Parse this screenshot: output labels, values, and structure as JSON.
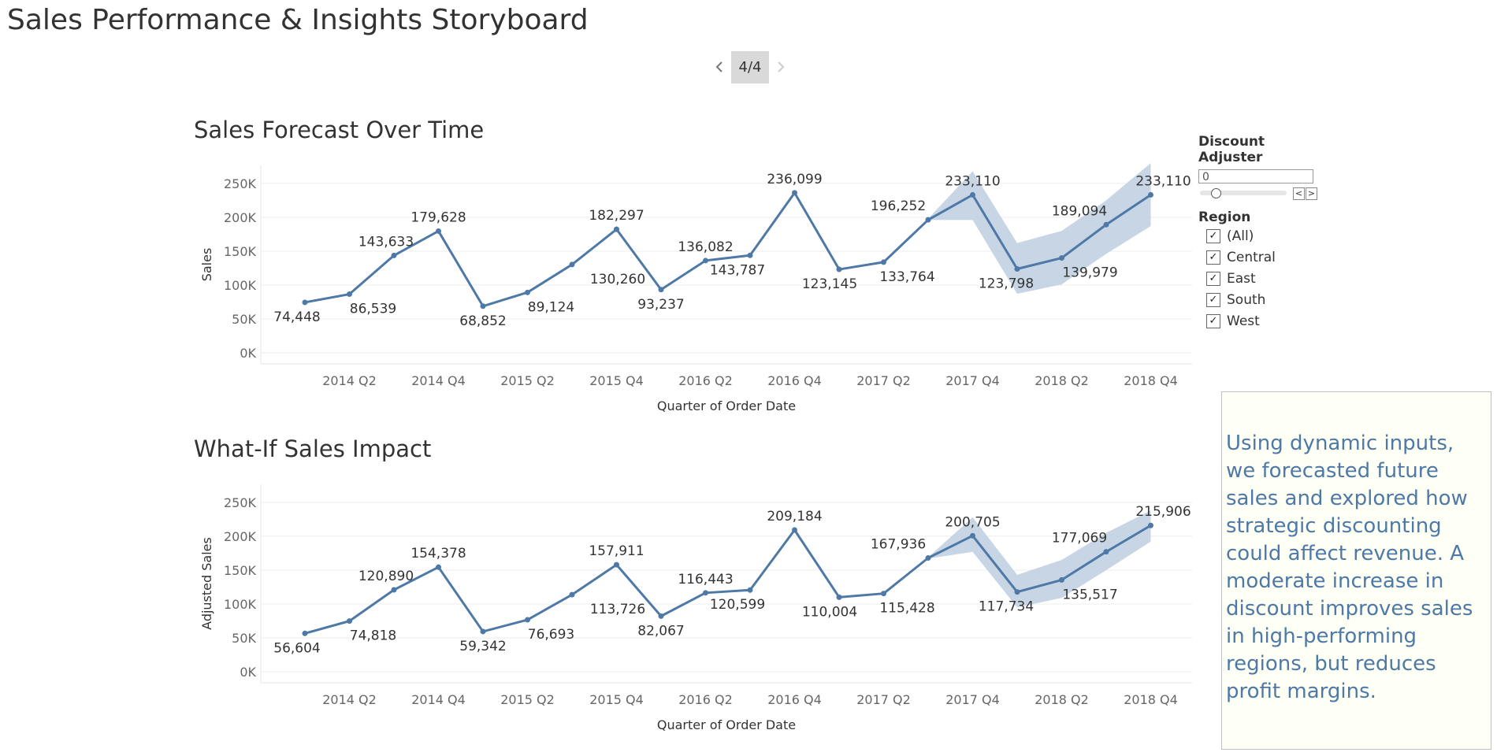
{
  "story_title": "Sales Performance & Insights Storyboard",
  "navigator": {
    "prev_icon": "chevron-left-icon",
    "next_icon": "chevron-right-icon",
    "page_label": "4/4"
  },
  "colors": {
    "line": "#4e79a7",
    "band": "#c1d0e1",
    "note_text": "#4e79a7",
    "note_bg": "#fefff5"
  },
  "controls": {
    "discount_title": "Discount Adjuster",
    "discount_value": "0",
    "decrement_icon": "<",
    "increment_icon": ">",
    "region_title": "Region",
    "region_options": [
      {
        "label": "(All)",
        "checked": true
      },
      {
        "label": "Central",
        "checked": true
      },
      {
        "label": "East",
        "checked": true
      },
      {
        "label": "South",
        "checked": true
      },
      {
        "label": "West",
        "checked": true
      }
    ]
  },
  "insight_text": "Using dynamic inputs, we forecasted future sales and explored how strategic discounting could affect revenue. A moderate increase in discount improves sales in high-performing regions, but reduces profit margins.",
  "chart_data": [
    {
      "type": "line",
      "title": "Sales Forecast Over Time",
      "xlabel": "Quarter of Order Date",
      "ylabel": "Sales",
      "x_tick_labels": [
        "2014 Q2",
        "2014 Q4",
        "2015 Q2",
        "2015 Q4",
        "2016 Q2",
        "2016 Q4",
        "2017 Q2",
        "2017 Q4",
        "2018 Q2",
        "2018 Q4"
      ],
      "y_ticks": [
        0,
        50000,
        100000,
        150000,
        200000,
        250000
      ],
      "y_tick_labels": [
        "0K",
        "50K",
        "100K",
        "150K",
        "200K",
        "250K"
      ],
      "ylim": [
        0,
        265000
      ],
      "grid": true,
      "x": [
        "2014 Q1",
        "2014 Q2",
        "2014 Q3",
        "2014 Q4",
        "2015 Q1",
        "2015 Q2",
        "2015 Q3",
        "2015 Q4",
        "2016 Q1",
        "2016 Q2",
        "2016 Q3",
        "2016 Q4",
        "2017 Q1",
        "2017 Q2",
        "2017 Q3",
        "2017 Q4",
        "2018 Q1",
        "2018 Q2",
        "2018 Q3",
        "2018 Q4"
      ],
      "values": [
        74448,
        86539,
        143633,
        179628,
        68852,
        89124,
        130260,
        182297,
        93237,
        136082,
        143787,
        236099,
        123145,
        133764,
        196252,
        233110,
        123798,
        139979,
        189094,
        233110
      ],
      "data_labels": [
        "74,448",
        "86,539",
        "143,633",
        "179,628",
        "68,852",
        "89,124",
        "130,260",
        "182,297",
        "93,237",
        "136,082",
        "143,787",
        "236,099",
        "123,145",
        "133,764",
        "196,252",
        "233,110",
        "123,798",
        "139,979",
        "189,094",
        "233,110"
      ],
      "forecast_band": {
        "start_index": 14,
        "upper": [
          198000,
          268000,
          162000,
          180000,
          225000,
          280000
        ],
        "lower": [
          196000,
          196000,
          87000,
          101000,
          146000,
          187000
        ]
      }
    },
    {
      "type": "line",
      "title": "What-If Sales Impact",
      "xlabel": "Quarter of Order Date",
      "ylabel": "Adjusted Sales",
      "x_tick_labels": [
        "2014 Q2",
        "2014 Q4",
        "2015 Q2",
        "2015 Q4",
        "2016 Q2",
        "2016 Q4",
        "2017 Q2",
        "2017 Q4",
        "2018 Q2",
        "2018 Q4"
      ],
      "y_ticks": [
        0,
        50000,
        100000,
        150000,
        200000,
        250000
      ],
      "y_tick_labels": [
        "0K",
        "50K",
        "100K",
        "150K",
        "200K",
        "250K"
      ],
      "ylim": [
        0,
        265000
      ],
      "grid": true,
      "x": [
        "2014 Q1",
        "2014 Q2",
        "2014 Q3",
        "2014 Q4",
        "2015 Q1",
        "2015 Q2",
        "2015 Q3",
        "2015 Q4",
        "2016 Q1",
        "2016 Q2",
        "2016 Q3",
        "2016 Q4",
        "2017 Q1",
        "2017 Q2",
        "2017 Q3",
        "2017 Q4",
        "2018 Q1",
        "2018 Q2",
        "2018 Q3",
        "2018 Q4"
      ],
      "values": [
        56604,
        74818,
        120890,
        154378,
        59342,
        76693,
        113726,
        157911,
        82067,
        116443,
        120599,
        209184,
        110004,
        115428,
        167936,
        200705,
        117734,
        135517,
        177069,
        215906
      ],
      "data_labels": [
        "56,604",
        "74,818",
        "120,890",
        "154,378",
        "59,342",
        "76,693",
        "113,726",
        "157,911",
        "82,067",
        "116,443",
        "120,599",
        "209,184",
        "110,004",
        "115,428",
        "167,936",
        "200,705",
        "117,734",
        "135,517",
        "177,069",
        "215,906"
      ],
      "forecast_band": {
        "start_index": 14,
        "upper": [
          169000,
          228000,
          143000,
          165000,
          205000,
          238000
        ],
        "lower": [
          167000,
          177000,
          95000,
          109000,
          150000,
          192000
        ]
      }
    }
  ]
}
